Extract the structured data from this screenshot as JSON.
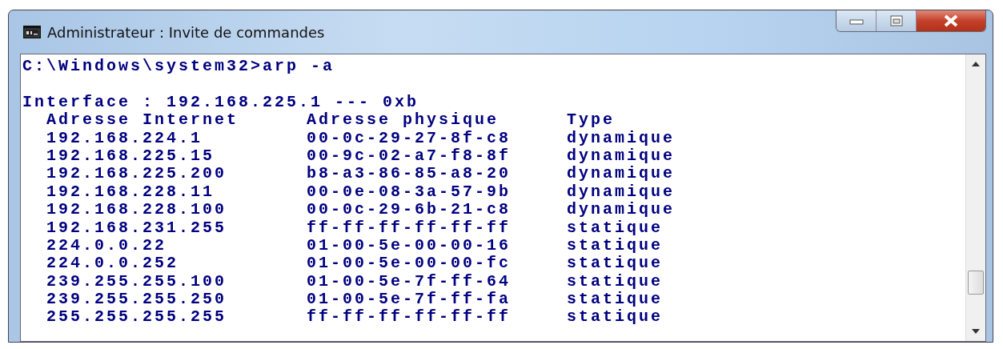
{
  "window": {
    "title": "Administrateur : Invite de commandes"
  },
  "console": {
    "prompt": "C:\\Windows\\system32>arp -a",
    "interface": "Interface : 192.168.225.1 --- 0xb",
    "columns": [
      "Adresse Internet",
      "Adresse physique",
      "Type"
    ],
    "rows": [
      [
        "192.168.224.1",
        "00-0c-29-27-8f-c8",
        "dynamique"
      ],
      [
        "192.168.225.15",
        "00-9c-02-a7-f8-8f",
        "dynamique"
      ],
      [
        "192.168.225.200",
        "b8-a3-86-85-a8-20",
        "dynamique"
      ],
      [
        "192.168.228.11",
        "00-0e-08-3a-57-9b",
        "dynamique"
      ],
      [
        "192.168.228.100",
        "00-0c-29-6b-21-c8",
        "dynamique"
      ],
      [
        "192.168.231.255",
        "ff-ff-ff-ff-ff-ff",
        "statique"
      ],
      [
        "224.0.0.22",
        "01-00-5e-00-00-16",
        "statique"
      ],
      [
        "224.0.0.252",
        "01-00-5e-00-00-fc",
        "statique"
      ],
      [
        "239.255.255.100",
        "01-00-5e-7f-ff-64",
        "statique"
      ],
      [
        "239.255.255.250",
        "01-00-5e-7f-ff-fa",
        "statique"
      ],
      [
        "255.255.255.255",
        "ff-ff-ff-ff-ff-ff",
        "statique"
      ]
    ]
  }
}
